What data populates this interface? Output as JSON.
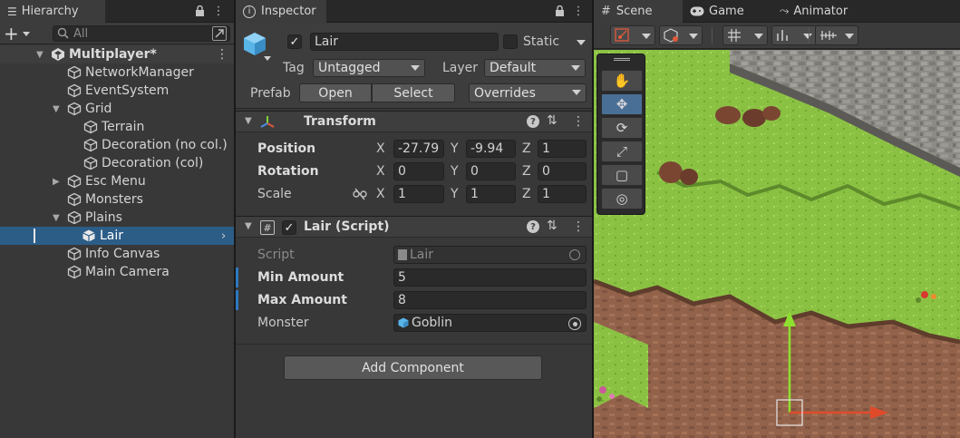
{
  "hierarchy": {
    "tab_label": "Hierarchy",
    "search_placeholder": "All",
    "scene_name": "Multiplayer*",
    "items": [
      {
        "label": "NetworkManager"
      },
      {
        "label": "EventSystem"
      },
      {
        "label": "Grid"
      },
      {
        "label": "Terrain"
      },
      {
        "label": "Decoration (no col.)"
      },
      {
        "label": "Decoration (col)"
      },
      {
        "label": "Esc Menu"
      },
      {
        "label": "Monsters"
      },
      {
        "label": "Plains"
      },
      {
        "label": "Lair"
      },
      {
        "label": "Info Canvas"
      },
      {
        "label": "Main Camera"
      }
    ]
  },
  "inspector": {
    "tab_label": "Inspector",
    "object_name": "Lair",
    "static_label": "Static",
    "tag_label": "Tag",
    "tag_value": "Untagged",
    "layer_label": "Layer",
    "layer_value": "Default",
    "prefab_label": "Prefab",
    "open_label": "Open",
    "select_label": "Select",
    "overrides_label": "Overrides",
    "transform": {
      "title": "Transform",
      "position_label": "Position",
      "rotation_label": "Rotation",
      "scale_label": "Scale",
      "x": "X",
      "y": "Y",
      "z": "Z",
      "position": {
        "x": "-27.79",
        "y": "-9.94",
        "z": "1"
      },
      "rotation": {
        "x": "0",
        "y": "0",
        "z": "0"
      },
      "scale": {
        "x": "1",
        "y": "1",
        "z": "1"
      }
    },
    "script_component": {
      "title": "Lair (Script)",
      "script_label": "Script",
      "script_value": "Lair",
      "min_label": "Min Amount",
      "min_value": "5",
      "max_label": "Max Amount",
      "max_value": "8",
      "monster_label": "Monster",
      "monster_value": "Goblin"
    },
    "add_component_label": "Add Component"
  },
  "scene": {
    "scene_tab": "Scene",
    "game_tab": "Game",
    "animator_tab": "Animator"
  },
  "colors": {
    "selection": "#2c5d87",
    "accent": "#2e78c0",
    "grass": "#8fc24a",
    "dirt": "#8a5a44"
  }
}
